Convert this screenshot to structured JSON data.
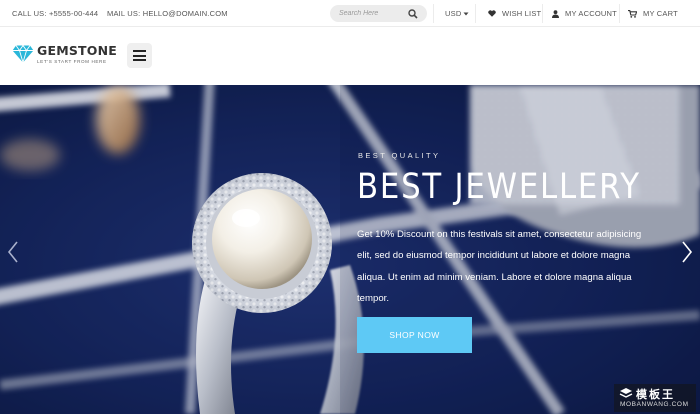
{
  "topbar": {
    "call": "CALL US: +5555-00-444",
    "mail": "MAIL US: HELLO@DOMAIN.COM",
    "search_placeholder": "Search Here",
    "currency": "USD",
    "wishlist": "WISH LIST",
    "account": "MY ACCOUNT",
    "cart": "MY CART"
  },
  "header": {
    "brand": "GEMSTONE",
    "tagline": "LET'S START FROM HERE"
  },
  "hero": {
    "kicker": "BEST QUALITY",
    "headline": "BEST JEWELLERY",
    "description": "Get 10% Discount on this festivals sit amet, consectetur adipisicing elit, sed do eiusmod tempor incididunt ut labore et dolore magna aliqua. Ut enim ad minim veniam. Labore et dolore magna aliqua tempor.",
    "cta": "SHOP NOW"
  },
  "watermark": {
    "cn": "模板王",
    "en": "MOBANWANG.COM"
  },
  "colors": {
    "accent": "#5ec9f5",
    "logo": "#2ab7d9",
    "velvet": "#1a2c6b"
  }
}
